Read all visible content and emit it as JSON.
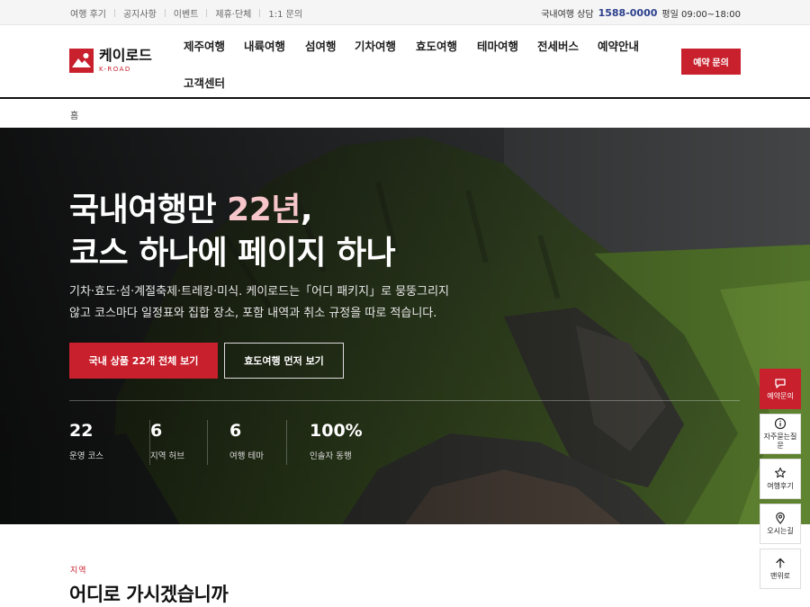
{
  "topbar": {
    "links": [
      "여행 후기",
      "공지사항",
      "이벤트",
      "제휴·단체",
      "1:1 문의"
    ],
    "phone_label": "국내여행 상담",
    "phone_number": "1588-0000",
    "hours": "평일 09:00~18:00"
  },
  "header": {
    "logo_name": "케이로드",
    "logo_sub": "K-ROAD",
    "nav": [
      "제주여행",
      "내륙여행",
      "섬여행",
      "기차여행",
      "효도여행",
      "테마여행",
      "전세버스",
      "예약안내",
      "고객센터"
    ],
    "cta": "예약 문의"
  },
  "breadcrumb": {
    "home": "홈"
  },
  "hero": {
    "title_line1_pre": "국내여행만 ",
    "title_line1_accent": "22년",
    "title_line1_post": ",",
    "title_line2": "코스 하나에 페이지 하나",
    "desc_line1": "기차·효도·섬·계절축제·트레킹·미식. 케이로드는「어디 패키지」로 뭉뚱그리지",
    "desc_line2": "않고 코스마다 일정표와 집합 장소, 포함 내역과 취소 규정을 따로 적습니다.",
    "btn_primary": "국내 상품 22개 전체 보기",
    "btn_secondary": "효도여행 먼저 보기",
    "stats": [
      {
        "value": "22",
        "label": "운영 코스"
      },
      {
        "value": "6",
        "label": "지역 허브"
      },
      {
        "value": "6",
        "label": "여행 테마"
      },
      {
        "value": "100%",
        "label": "인솔자 동행"
      }
    ]
  },
  "section": {
    "eyebrow": "지역",
    "title": "어디로 가시겠습니까"
  },
  "quick_menu": [
    {
      "label": "예약문의",
      "icon": "chat-icon"
    },
    {
      "label": "자주묻는질문",
      "icon": "info-icon"
    },
    {
      "label": "여행후기",
      "icon": "star-icon"
    },
    {
      "label": "오시는길",
      "icon": "map-pin-icon"
    },
    {
      "label": "맨위로",
      "icon": "arrow-up-icon"
    }
  ],
  "colors": {
    "brand": "#c8202d",
    "accent_text": "#f7c6cb",
    "phone": "#2b3f8c"
  }
}
